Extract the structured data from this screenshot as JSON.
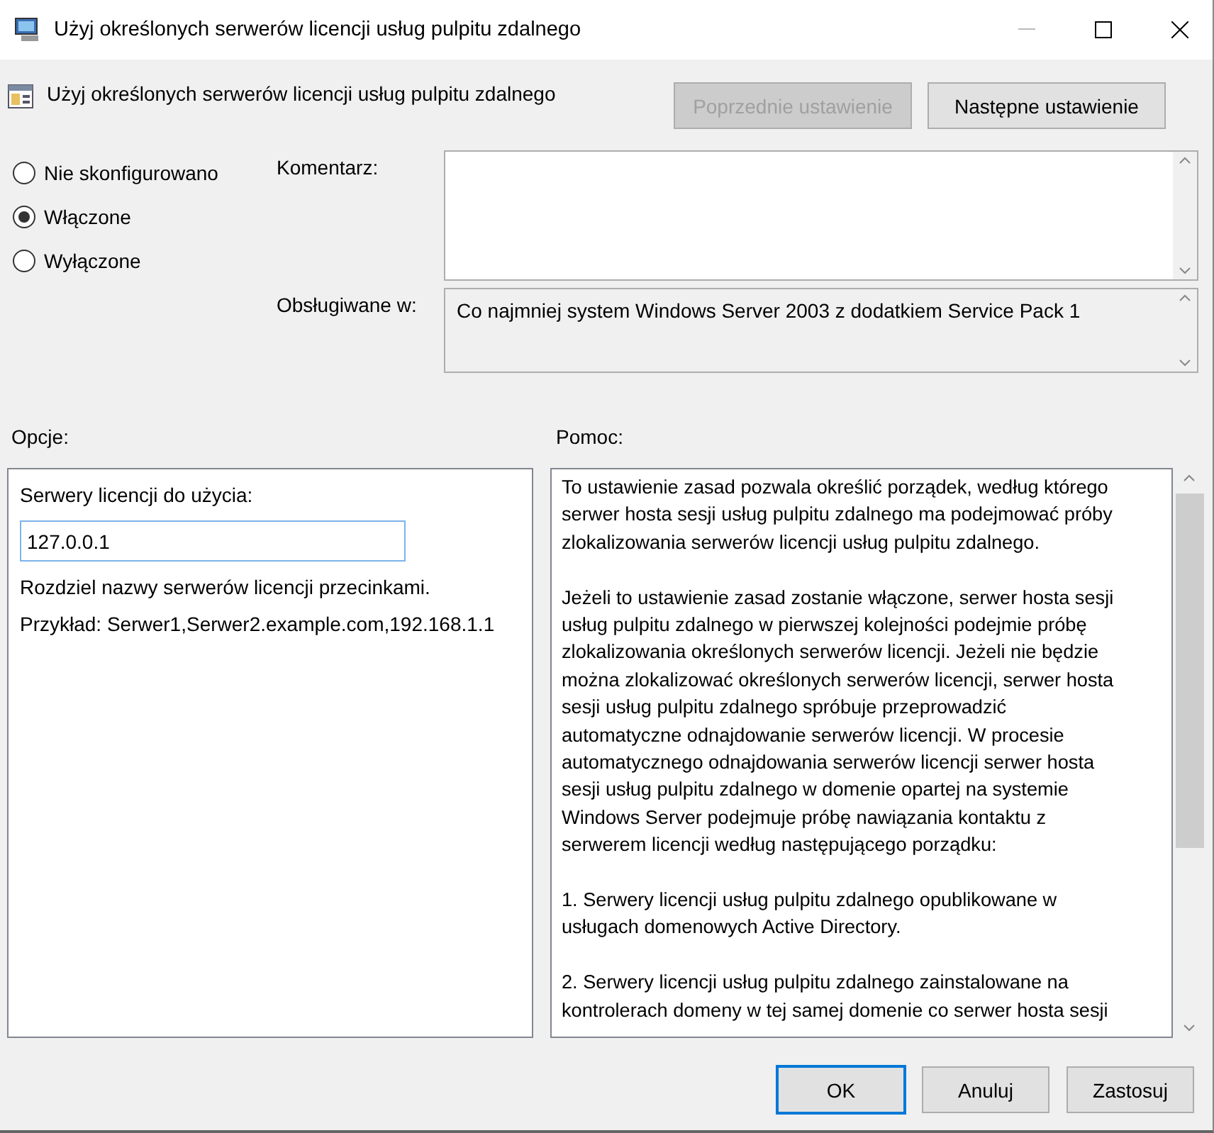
{
  "window": {
    "title": "Użyj określonych serwerów licencji usług pulpitu zdalnego"
  },
  "header": {
    "title": "Użyj określonych serwerów licencji usług pulpitu zdalnego",
    "buttons": [
      {
        "label": "Poprzednie ustawienie",
        "disabled": true
      },
      {
        "label": "Następne ustawienie",
        "disabled": false
      }
    ]
  },
  "state_options": [
    {
      "label": "Nie skonfigurowano",
      "selected": false
    },
    {
      "label": "Włączone",
      "selected": true
    },
    {
      "label": "Wyłączone",
      "selected": false
    }
  ],
  "comment": {
    "label": "Komentarz:"
  },
  "supported": {
    "label": "Obsługiwane w:",
    "value": "Co najmniej system Windows Server 2003 z dodatkiem Service Pack 1"
  },
  "options": {
    "heading": "Opcje:",
    "field_label": "Serwery licencji do użycia:",
    "value": "127.0.0.1",
    "hint": "Rozdziel nazwy serwerów licencji przecinkami.",
    "example": "Przykład: Serwer1,Serwer2.example.com,192.168.1.1"
  },
  "help": {
    "heading": "Pomoc:",
    "paragraphs": [
      {
        "lines": [
          "To ustawienie zasad pozwala określić porządek, według którego",
          "serwer hosta sesji usług pulpitu zdalnego ma podejmować próby",
          "zlokalizowania serwerów licencji usług pulpitu zdalnego."
        ]
      },
      {
        "lines": [
          "Jeżeli to ustawienie zasad zostanie włączone, serwer hosta sesji",
          "usług pulpitu zdalnego w pierwszej kolejności podejmie próbę",
          "zlokalizowania określonych serwerów licencji. Jeżeli nie będzie",
          "można zlokalizować określonych serwerów licencji, serwer hosta",
          "sesji usług pulpitu zdalnego spróbuje przeprowadzić",
          "automatyczne odnajdowanie serwerów licencji. W procesie",
          "automatycznego odnajdowania serwerów licencji serwer hosta",
          "sesji usług pulpitu zdalnego w domenie opartej na systemie",
          "Windows Server podejmuje próbę nawiązania kontaktu z",
          "serwerem licencji według następującego porządku:"
        ]
      },
      {
        "lines": [
          "1. Serwery licencji usług pulpitu zdalnego opublikowane w",
          "usługach domenowych Active Directory."
        ]
      },
      {
        "lines": [
          "2. Serwery licencji usług pulpitu zdalnego zainstalowane na",
          "kontrolerach domeny w tej samej domenie co serwer hosta sesji"
        ]
      }
    ]
  },
  "footer": {
    "buttons": [
      {
        "label": "OK",
        "selected": true
      },
      {
        "label": "Anuluj",
        "selected": false
      },
      {
        "label": "Zastosuj",
        "selected": false
      }
    ]
  }
}
